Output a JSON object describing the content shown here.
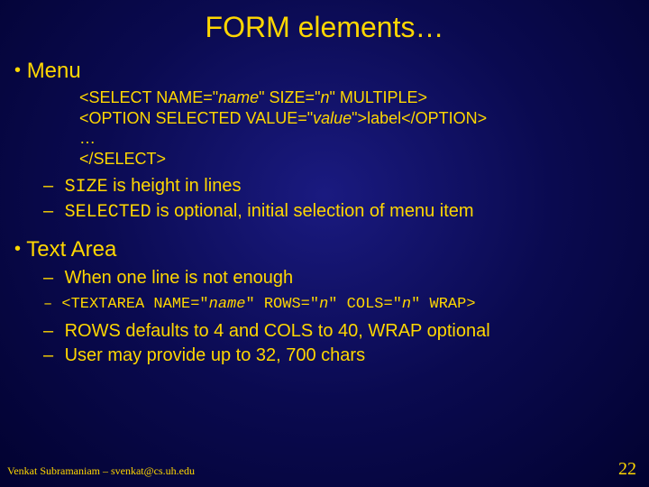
{
  "title": "FORM elements…",
  "bullets": {
    "menu": "Menu",
    "textarea": "Text Area"
  },
  "code1": {
    "line1a": "<SELECT NAME=\"",
    "line1b": "name",
    "line1c": "\" SIZE=\"",
    "line1d": "n",
    "line1e": "\" MULTIPLE>",
    "line2a": "<OPTION SELECTED VALUE=\"",
    "line2b": "value",
    "line2c": "\">label</OPTION>",
    "line3": "…",
    "line4": "</SELECT>"
  },
  "sub1": {
    "size_code": "SIZE",
    "size_rest": " is height in lines",
    "sel_code": "SELECTED",
    "sel_rest": " is optional, initial selection of menu item"
  },
  "sub2": {
    "line1": "When one line is not enough",
    "code_a": "<TEXTAREA NAME=\"",
    "code_b": "name",
    "code_c": "\" ROWS=\"",
    "code_d": "n",
    "code_e": "\" COLS=\"",
    "code_f": "n",
    "code_g": "\" WRAP>",
    "line3": "ROWS defaults to 4 and COLS to 40, WRAP optional",
    "line4": "User may provide up to 32, 700 chars"
  },
  "footer": {
    "left": "Venkat Subramaniam – svenkat@cs.uh.edu",
    "right": "22"
  }
}
